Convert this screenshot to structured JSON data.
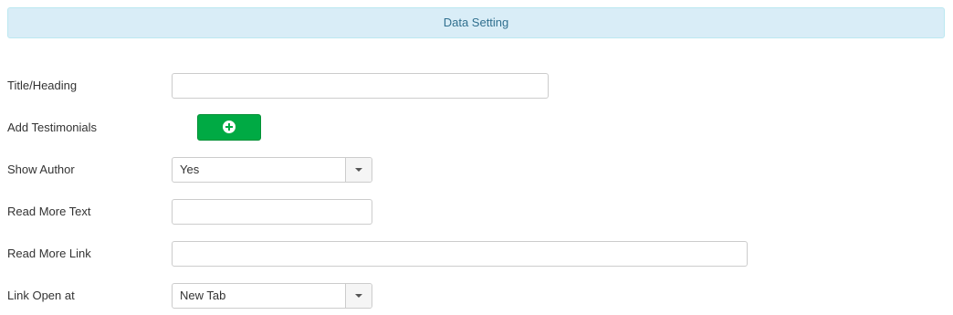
{
  "header": {
    "title": "Data Setting"
  },
  "form": {
    "title_heading": {
      "label": "Title/Heading",
      "value": ""
    },
    "add_testimonials": {
      "label": "Add Testimonials",
      "icon": "plus-circle-icon"
    },
    "show_author": {
      "label": "Show Author",
      "selected": "Yes"
    },
    "read_more_text": {
      "label": "Read More Text",
      "value": ""
    },
    "read_more_link": {
      "label": "Read More Link",
      "value": ""
    },
    "link_open_at": {
      "label": "Link Open at",
      "selected": "New Tab"
    }
  },
  "colors": {
    "header_bg": "#d9edf7",
    "header_text": "#31708f",
    "add_button": "#00aa44"
  }
}
